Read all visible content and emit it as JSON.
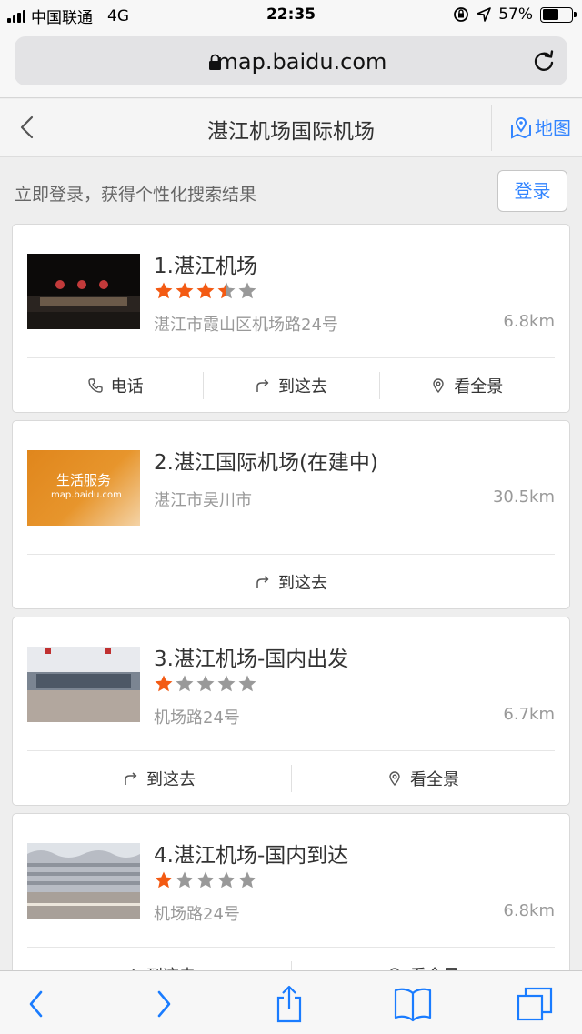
{
  "status_bar": {
    "carrier": "中国联通",
    "network": "4G",
    "time": "22:35",
    "battery": "57%",
    "battery_level": 0.57
  },
  "browser": {
    "url": "map.baidu.com"
  },
  "header": {
    "title": "湛江机场国际机场",
    "map_label": "地图"
  },
  "login": {
    "tip": "立即登录，获得个性化搜索结果",
    "button": "登录"
  },
  "results": [
    {
      "title": "1.湛江机场",
      "rating": 3.5,
      "address": "湛江市霞山区机场路24号",
      "distance": "6.8km",
      "actions": [
        "电话",
        "到这去",
        "看全景"
      ]
    },
    {
      "title": "2.湛江国际机场(在建中)",
      "address": "湛江市吴川市",
      "distance": "30.5km",
      "thumb_text": "生活服务",
      "thumb_sub": "map.baidu.com",
      "actions": [
        "到这去"
      ]
    },
    {
      "title": "3.湛江机场-国内出发",
      "rating": 1,
      "address": "机场路24号",
      "distance": "6.7km",
      "actions": [
        "到这去",
        "看全景"
      ]
    },
    {
      "title": "4.湛江机场-国内到达",
      "rating": 1,
      "address": "机场路24号",
      "distance": "6.8km",
      "actions": [
        "到这去",
        "看全景"
      ]
    }
  ],
  "colors": {
    "accent": "#3385ff",
    "star_on": "#f35a13",
    "star_off": "#999999"
  }
}
